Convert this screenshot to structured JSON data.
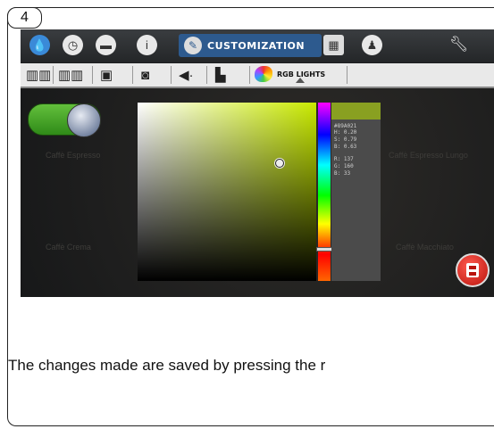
{
  "step_number": "4",
  "topbar": {
    "tab_customization_label": "CUSTOMIZATION",
    "icons": [
      "water-drop-icon",
      "clock-icon",
      "cup-icon",
      "info-icon",
      "pen-icon",
      "keyboard-icon",
      "person-icon",
      "wrench-icon"
    ]
  },
  "subbar": {
    "rgb_tab_label": "RGB LIGHTS",
    "icons": [
      "book-icon",
      "book-open-icon",
      "picture-icon",
      "screensaver-icon",
      "speaker-icon",
      "bottle-icon",
      "palette-icon"
    ]
  },
  "background_labels": [
    "Caffè Espresso",
    "Caffè Espresso Lungo",
    "Caffè Crema",
    "Caffè Macchiato"
  ],
  "color_picker": {
    "hex": "#89A021",
    "h": "0.20",
    "s": "0.79",
    "b": "0.63",
    "r": "137",
    "g": "160",
    "b_val": "33"
  },
  "colors": {
    "selected_color": "#89A021",
    "toggle_on": "#4aa82a",
    "save_button": "#d7241b"
  },
  "caption": "The changes made are saved by pressing the r"
}
